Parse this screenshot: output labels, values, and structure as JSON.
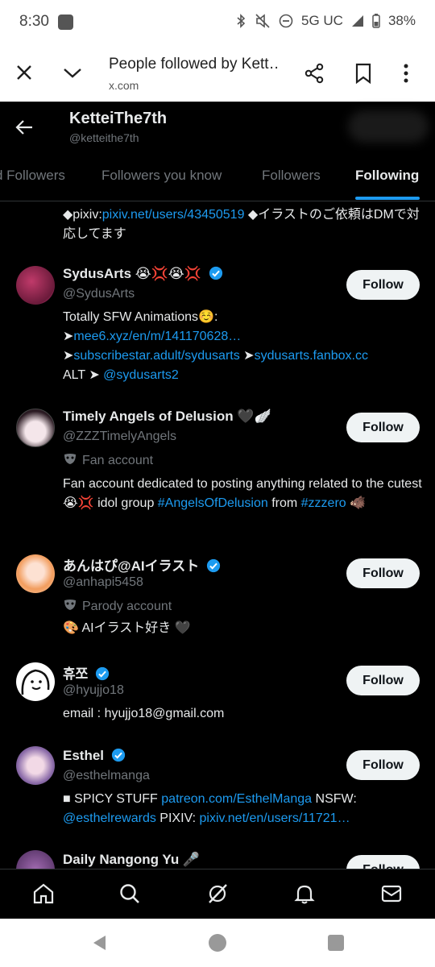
{
  "status_bar": {
    "time": "8:30",
    "network": "5G UC",
    "battery": "38%"
  },
  "browser": {
    "title": "People followed by Kett…",
    "url": "x.com"
  },
  "profile": {
    "name": "KetteiThe7th",
    "handle": "@ketteithe7th"
  },
  "tabs": [
    {
      "label": "d Followers"
    },
    {
      "label": "Followers you know"
    },
    {
      "label": "Followers"
    },
    {
      "label": "Following",
      "active": true
    }
  ],
  "feed": {
    "pre_bio": {
      "diamond1": "◆pixiv:",
      "link1": "pixiv.net/users/43450519",
      "rest": " ◆イラストのご依頼はDMで対応してます"
    },
    "users": [
      {
        "name": "SydusArts 😭💢😭💢",
        "handle": "@SydusArts",
        "verified": true,
        "follow": "Follow",
        "bio_line1": "Totally SFW Animations☺️:",
        "bio_arrow1": "➤",
        "bio_link1": "mee6.xyz/en/m/141170628…",
        "bio_arrow2": "➤",
        "bio_link2": "subscribestar.adult/sydusarts",
        "bio_arrow3": " ➤",
        "bio_link3": "sydusarts.fanbox.cc",
        "bio_alt": "ALT ➤ ",
        "bio_link4": "@sydusarts2"
      },
      {
        "name": "Timely Angels of Delusion 🖤🪽",
        "handle": "@ZZZTimelyAngels",
        "tag": "Fan account",
        "follow": "Follow",
        "bio_text1": "Fan account dedicated to posting anything related to the cutest 😭💢 idol group ",
        "bio_link1": "#AngelsOfDelusion",
        "bio_text2": " from ",
        "bio_link2": "#zzzero",
        "bio_text3": " 🐗"
      },
      {
        "name": "あんはぴ@AIイラスト",
        "handle": "@anhapi5458",
        "verified": true,
        "tag": "Parody account",
        "follow": "Follow",
        "bio": "🎨 AIイラスト好き 🖤"
      },
      {
        "name": "휴쪼",
        "handle": "@hyujjo18",
        "verified": true,
        "follow": "Follow",
        "bio": "email : hyujjo18@gmail.com"
      },
      {
        "name": "Esthel",
        "handle": "@esthelmanga",
        "verified": true,
        "follow": "Follow",
        "bio_text1": "■ SPICY STUFF ",
        "bio_link1": "patreon.com/EsthelManga",
        "bio_text2": " NSFW: ",
        "bio_link2": "@esthelrewards",
        "bio_text3": " PIXIV: ",
        "bio_link3": "pixiv.net/en/users/11721…"
      },
      {
        "name": "Daily Nangong Yu 🎤",
        "follow": "Follow"
      }
    ]
  },
  "bottom_nav": [
    "home-icon",
    "search-icon",
    "grok-icon",
    "notifications-icon",
    "messages-icon"
  ],
  "colors": {
    "accent": "#1d9bf0",
    "background": "#000000",
    "secondary_text": "#71767b"
  }
}
